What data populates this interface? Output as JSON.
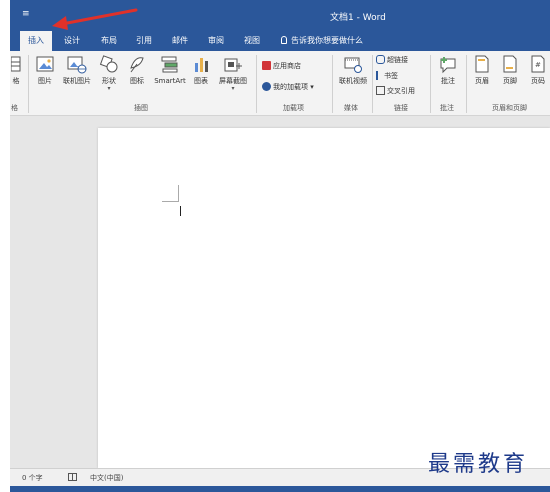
{
  "titlebar": {
    "qa_icon": "≡",
    "title": "文档1 - Word"
  },
  "tabs": [
    {
      "label": "插入",
      "active": true
    },
    {
      "label": "设计"
    },
    {
      "label": "布局"
    },
    {
      "label": "引用"
    },
    {
      "label": "邮件"
    },
    {
      "label": "审阅"
    },
    {
      "label": "视图"
    }
  ],
  "tell_me": "告诉我你想要做什么",
  "ribbon": {
    "table_label": "格",
    "buttons": [
      {
        "label": "图片",
        "icon": "picture-icon"
      },
      {
        "label": "联机图片",
        "icon": "online-picture-icon"
      },
      {
        "label": "形状",
        "icon": "shapes-icon",
        "dropdown": "▾"
      },
      {
        "label": "图标",
        "icon": "icons-icon"
      },
      {
        "label": "SmartArt",
        "icon": "smartart-icon"
      },
      {
        "label": "图表",
        "icon": "chart-icon"
      },
      {
        "label": "屏幕截图",
        "icon": "screenshot-icon",
        "dropdown": "▾"
      }
    ],
    "addins": {
      "store": "应用商店",
      "my_addins": "我的加载项",
      "dropdown": "▾"
    },
    "media_button": "联机视频",
    "links": {
      "link": "超链接",
      "bookmark": "书签",
      "cross_ref": "交叉引用"
    },
    "comment_button": "批注",
    "header_button": "页眉",
    "footer_button": "页脚",
    "page_number_button": "页码",
    "groups": {
      "tables": "格",
      "illustrations": "插图",
      "addins": "加载项",
      "media": "媒体",
      "links": "链接",
      "comments": "批注",
      "header_footer": "页眉和页脚"
    }
  },
  "statusbar": {
    "word_count": "0 个字",
    "language": "中文(中国)"
  },
  "watermark": "最需教育",
  "colors": {
    "brand": "#2b579a",
    "watermark": "#1e3a8a"
  }
}
